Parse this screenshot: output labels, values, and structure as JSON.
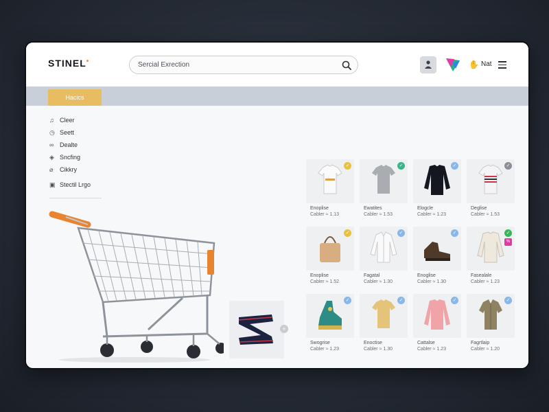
{
  "header": {
    "logo": "STINEL",
    "search_placeholder": "Sercial Exrection",
    "nav_label": "Nat"
  },
  "banner": {
    "button_label": "Hacics"
  },
  "sidebar": {
    "items": [
      {
        "label": "Cleer",
        "icon": "bell-icon"
      },
      {
        "label": "Seett",
        "icon": "clock-icon"
      },
      {
        "label": "Dealte",
        "icon": "link-icon"
      },
      {
        "label": "Sncfing",
        "icon": "shield-icon"
      },
      {
        "label": "Cikkry",
        "icon": "tag-icon"
      },
      {
        "label": "Stectil Lrgo",
        "icon": "calendar-icon"
      }
    ]
  },
  "colors": {
    "accent": "#e8bd62",
    "banner": "#c8cfd8",
    "cart_handle": "#e8842f"
  },
  "products": [
    {
      "name": "Enoplise",
      "price": "Cabler ≈ 1.13",
      "icon": "white-tshirt",
      "badge_color": "#e6c240"
    },
    {
      "name": "Ewatites",
      "price": "Cabler ≈ 1.53",
      "icon": "gray-tshirt",
      "badge_color": "#3ab58a"
    },
    {
      "name": "Elogcle",
      "price": "Cabler ≈ 1.23",
      "icon": "black-longsleeve",
      "badge_color": "#8ab6e8"
    },
    {
      "name": "Deglise",
      "price": "Cabler ≈ 1.53",
      "icon": "striped-tshirt",
      "badge_color": "#8b9096"
    },
    {
      "name": "Enoplise",
      "price": "Cabler ≈ 1.52",
      "icon": "tan-handbag",
      "badge_color": "#e6c240"
    },
    {
      "name": "Fagatal",
      "price": "Cabler ≈ 1.30",
      "icon": "white-shirt",
      "badge_color": "#8ab6e8"
    },
    {
      "name": "Enoglise",
      "price": "Cabler ≈ 1.30",
      "icon": "brown-shoes",
      "badge_color": "#8ab6e8"
    },
    {
      "name": "Fasealale",
      "price": "Cabler ≈ 1.23",
      "icon": "cream-sweater",
      "badge_color": "#3ab55a",
      "badge2": true
    },
    {
      "name": "Swogrise",
      "price": "Cabler ≈ 1.23",
      "icon": "teal-sandal",
      "badge_color": "#8ab6e8"
    },
    {
      "name": "Enoctise",
      "price": "Cabler ≈ 1.30",
      "icon": "mustard-tshirt",
      "badge_color": "#8ab6e8"
    },
    {
      "name": "Cattalse",
      "price": "Cabler ≈ 1.23",
      "icon": "pink-sweater",
      "badge_color": "#8ab6e8"
    },
    {
      "name": "Fagrtlaip",
      "price": "Cabler ≈ 1.20",
      "icon": "olive-shirt",
      "badge_color": "#8ab6e8"
    }
  ]
}
